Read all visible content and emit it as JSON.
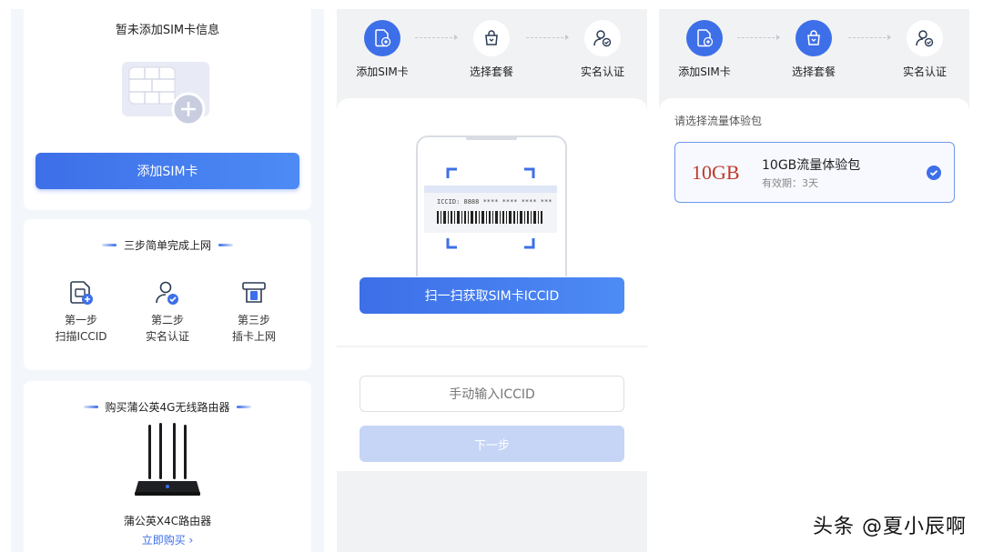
{
  "panel1": {
    "empty_title": "暂未添加SIM卡信息",
    "add_button": "添加SIM卡",
    "steps_title": "三步简单完成上网",
    "steps": [
      {
        "icon": "scan-card-icon",
        "line1": "第一步",
        "line2": "扫描ICCID"
      },
      {
        "icon": "user-verify-icon",
        "line1": "第二步",
        "line2": "实名认证"
      },
      {
        "icon": "insert-sim-icon",
        "line1": "第三步",
        "line2": "插卡上网"
      }
    ],
    "buy_title": "购买蒲公英4G无线路由器",
    "product_name": "蒲公英X4C路由器",
    "buy_link": "立即购买 ›"
  },
  "panel2": {
    "steps": [
      "添加SIM卡",
      "选择套餐",
      "实名认证"
    ],
    "iccid_label": "ICCID: 8888 **** **** **** ***",
    "scan_button": "扫一扫获取SIM卡ICCID",
    "manual_placeholder": "手动输入ICCID",
    "next_button": "下一步"
  },
  "panel3": {
    "steps": [
      "添加SIM卡",
      "选择套餐",
      "实名认证"
    ],
    "prompt": "请选择流量体验包",
    "plan_size": "10GB",
    "plan_name": "10GB流量体验包",
    "plan_validity": "有效期：3天"
  },
  "watermark": "头条 @夏小辰啊",
  "colors": {
    "accent": "#3d6fe8",
    "plan_red": "#c0392b",
    "disabled": "#c6d5f6"
  }
}
